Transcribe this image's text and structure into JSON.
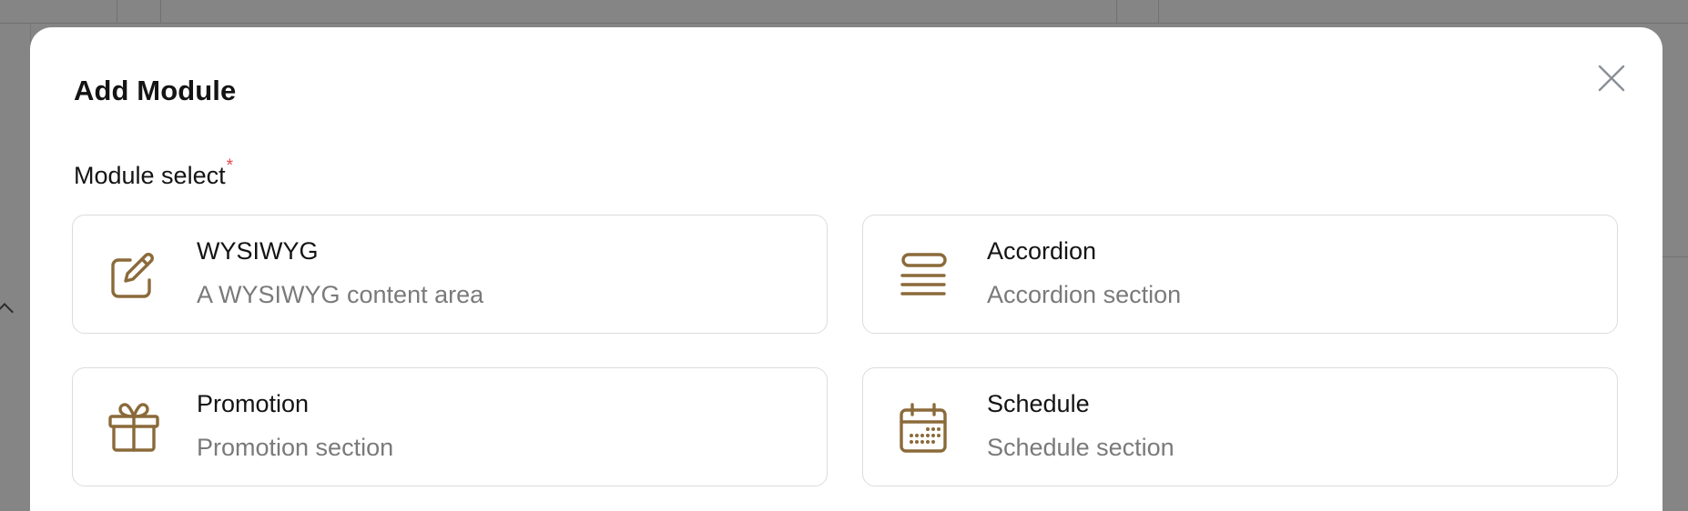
{
  "colors": {
    "accent_icon": "#8B6A3A",
    "required": "#E5484D",
    "overlay": "rgba(0,0,0,0.48)",
    "muted_text": "#7A7A7A",
    "border": "#DCDCDC"
  },
  "modal": {
    "title": "Add Module",
    "close_icon": "close-icon",
    "field_label": "Module select",
    "required_mark": "*"
  },
  "modules": [
    {
      "title": "WYSIWYG",
      "description": "A WYSIWYG content area",
      "icon": "edit-pencil-icon"
    },
    {
      "title": "Accordion",
      "description": "Accordion section",
      "icon": "accordion-lines-icon"
    },
    {
      "title": "Promotion",
      "description": "Promotion section",
      "icon": "gift-icon"
    },
    {
      "title": "Schedule",
      "description": "Schedule section",
      "icon": "calendar-icon"
    }
  ]
}
